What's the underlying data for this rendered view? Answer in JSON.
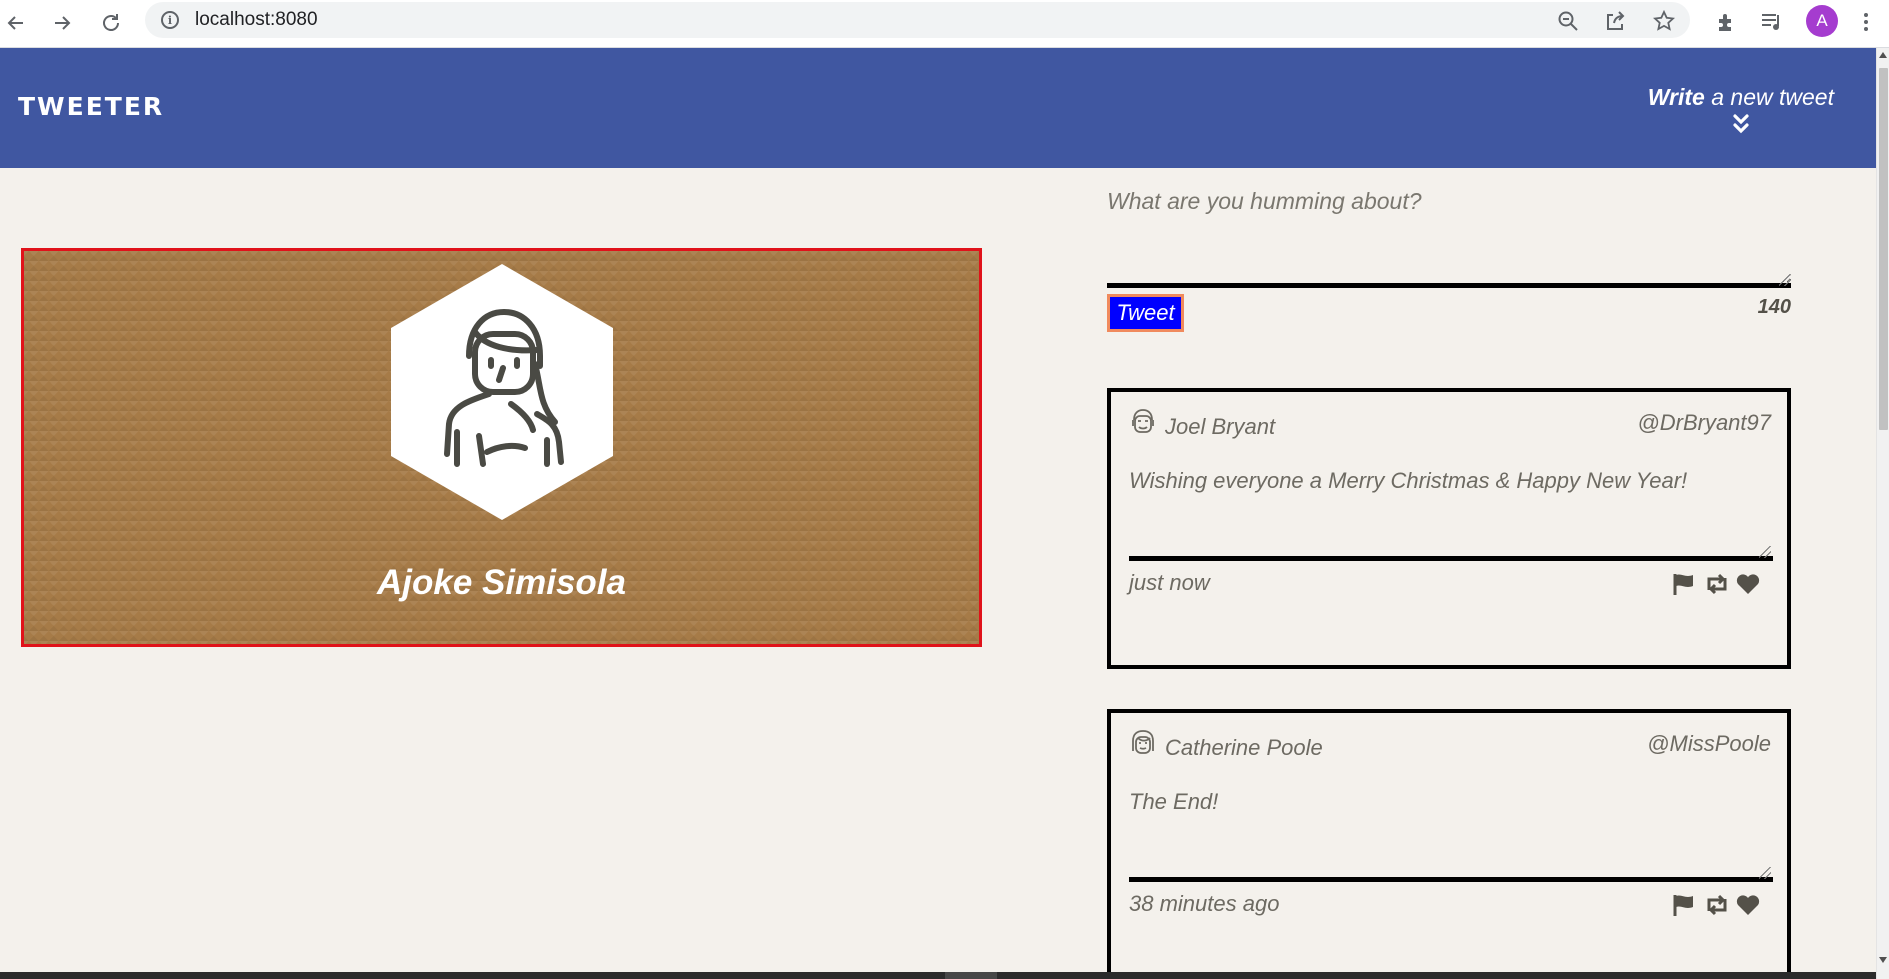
{
  "browser": {
    "url": "localhost:8080",
    "profile_initial": "A",
    "icons": [
      "back-icon",
      "forward-icon",
      "reload-icon",
      "info-icon",
      "zoom-out-icon",
      "share-icon",
      "bookmark-star-icon",
      "extensions-puzzle-icon",
      "media-queue-icon",
      "kebab-menu-icon"
    ]
  },
  "header": {
    "brand": "TWEETER",
    "compose_bold": "Write",
    "compose_rest": " a new tweet",
    "chevron_icon": "double-chevron-down-icon"
  },
  "profile": {
    "name": "Ajoke Simisola",
    "avatar_icon": "woman-avatar-icon"
  },
  "composer": {
    "placeholder": "What are you humming about?",
    "button_label": "Tweet",
    "counter": "140"
  },
  "tweets": [
    {
      "name": "Joel Bryant",
      "handle": "@DrBryant97",
      "text": "Wishing everyone a Merry Christmas & Happy New Year!",
      "time": "just now",
      "avatar_icon": "man-face-icon"
    },
    {
      "name": "Catherine Poole",
      "handle": "@MissPoole",
      "text": "The End!",
      "time": "38 minutes ago",
      "avatar_icon": "woman-face-icon"
    }
  ],
  "colors": {
    "header_bg": "#4057a1",
    "page_bg": "#f4f1ec",
    "card_bg": "#a67b48",
    "card_border": "#e0121a",
    "tweet_button_bg": "#0000ff",
    "tweet_button_border": "#f08a5d",
    "action_icon": "#545149"
  }
}
